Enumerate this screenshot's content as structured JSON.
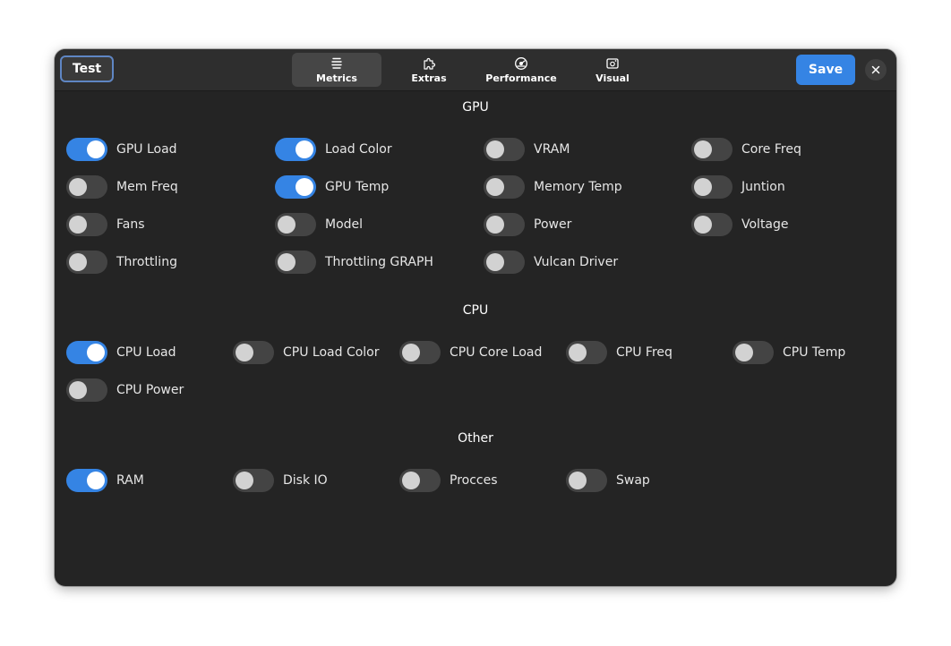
{
  "header": {
    "test_label": "Test",
    "save_label": "Save",
    "tabs": [
      {
        "label": "Metrics",
        "icon": "list-icon",
        "active": true
      },
      {
        "label": "Extras",
        "icon": "puzzle-icon",
        "active": false
      },
      {
        "label": "Performance",
        "icon": "gauge-icon",
        "active": false
      },
      {
        "label": "Visual",
        "icon": "picture-icon",
        "active": false
      }
    ]
  },
  "colors": {
    "accent": "#3584e4",
    "window_bg": "#242424",
    "switch_off": "#444444"
  },
  "sections": {
    "gpu": {
      "title": "GPU",
      "items": [
        {
          "label": "GPU Load",
          "on": true
        },
        {
          "label": "Load Color",
          "on": true
        },
        {
          "label": "VRAM",
          "on": false
        },
        {
          "label": "Core Freq",
          "on": false
        },
        {
          "label": "Mem Freq",
          "on": false
        },
        {
          "label": "GPU Temp",
          "on": true
        },
        {
          "label": "Memory Temp",
          "on": false
        },
        {
          "label": "Juntion",
          "on": false
        },
        {
          "label": "Fans",
          "on": false
        },
        {
          "label": "Model",
          "on": false
        },
        {
          "label": "Power",
          "on": false
        },
        {
          "label": "Voltage",
          "on": false
        },
        {
          "label": "Throttling",
          "on": false
        },
        {
          "label": "Throttling GRAPH",
          "on": false
        },
        {
          "label": "Vulcan Driver",
          "on": false
        }
      ]
    },
    "cpu": {
      "title": "CPU",
      "items": [
        {
          "label": "CPU Load",
          "on": true
        },
        {
          "label": "CPU Load Color",
          "on": false
        },
        {
          "label": "CPU Core Load",
          "on": false
        },
        {
          "label": "CPU Freq",
          "on": false
        },
        {
          "label": "CPU Temp",
          "on": false
        },
        {
          "label": "CPU Power",
          "on": false
        }
      ]
    },
    "other": {
      "title": "Other",
      "items": [
        {
          "label": "RAM",
          "on": true
        },
        {
          "label": "Disk IO",
          "on": false
        },
        {
          "label": "Procces",
          "on": false
        },
        {
          "label": "Swap",
          "on": false
        }
      ]
    }
  }
}
